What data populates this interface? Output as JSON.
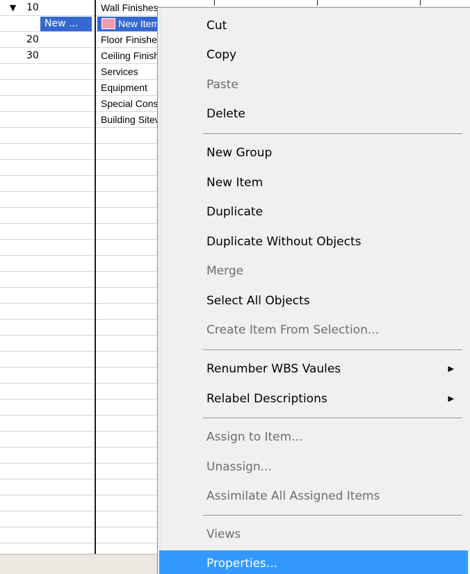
{
  "outline": {
    "rows": [
      {
        "toggle": "▼",
        "number": "10",
        "description": "Wall Finishes",
        "selected": false,
        "has_swatch": false
      },
      {
        "toggle": "",
        "number": "New ...",
        "description": "New Item",
        "selected": true,
        "has_swatch": true
      },
      {
        "toggle": "",
        "number": "20",
        "description": "Floor Finishes",
        "selected": false,
        "has_swatch": false
      },
      {
        "toggle": "",
        "number": "30",
        "description": "Ceiling Finishes",
        "selected": false,
        "has_swatch": false
      },
      {
        "toggle": "",
        "number": "",
        "description": "Services",
        "selected": false,
        "has_swatch": false
      },
      {
        "toggle": "",
        "number": "",
        "description": "Equipment",
        "selected": false,
        "has_swatch": false
      },
      {
        "toggle": "",
        "number": "",
        "description": "Special Construction",
        "selected": false,
        "has_swatch": false
      },
      {
        "toggle": "",
        "number": "",
        "description": "Building Sitework",
        "selected": false,
        "has_swatch": false
      }
    ],
    "swatch_color": "#f59bb3",
    "selection_color": "#3569d0"
  },
  "context_menu": {
    "highlight_color": "#3399ff",
    "items": [
      {
        "label": "Cut",
        "enabled": true
      },
      {
        "label": "Copy",
        "enabled": true
      },
      {
        "label": "Paste",
        "enabled": false
      },
      {
        "label": "Delete",
        "enabled": true
      },
      {
        "label": "New Group",
        "enabled": true
      },
      {
        "label": "New Item",
        "enabled": true
      },
      {
        "label": "Duplicate",
        "enabled": true
      },
      {
        "label": "Duplicate Without Objects",
        "enabled": true
      },
      {
        "label": "Merge",
        "enabled": false
      },
      {
        "label": "Select All Objects",
        "enabled": true
      },
      {
        "label": "Create Item From Selection...",
        "enabled": false
      },
      {
        "label": "Renumber WBS Vaules",
        "enabled": true,
        "submenu": true
      },
      {
        "label": "Relabel Descriptions",
        "enabled": true,
        "submenu": true
      },
      {
        "label": "Assign to Item...",
        "enabled": false
      },
      {
        "label": "Unassign...",
        "enabled": false
      },
      {
        "label": "Assimilate All Assigned Items",
        "enabled": false
      },
      {
        "label": "Views",
        "enabled": false
      },
      {
        "label": "Properties...",
        "enabled": true,
        "highlighted": true
      }
    ],
    "submenu_arrow": "▶"
  }
}
